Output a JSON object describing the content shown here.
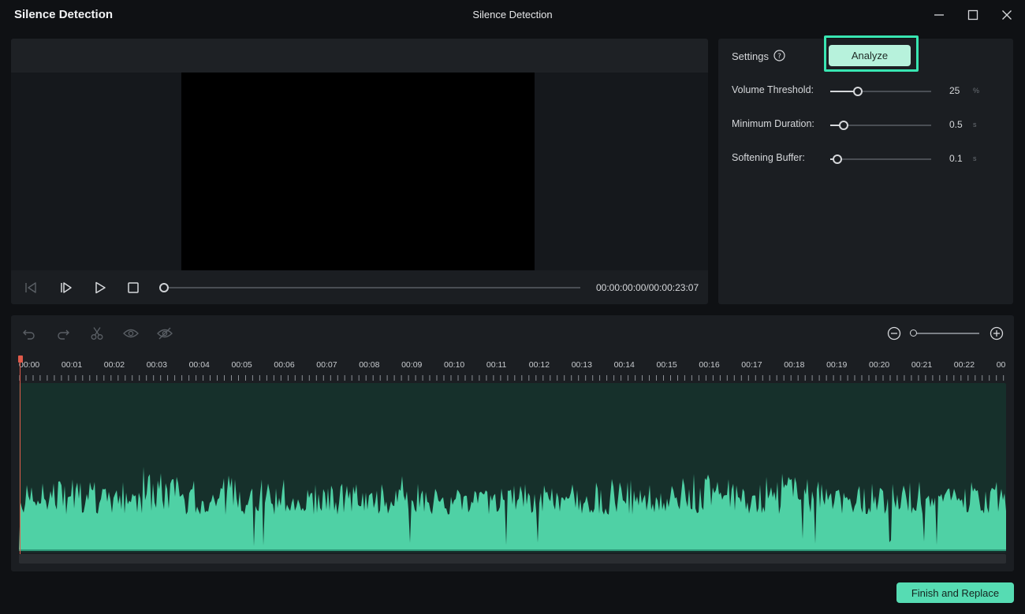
{
  "window": {
    "app_title": "Silence Detection",
    "center_title": "Silence Detection",
    "controls": [
      "minimize-icon",
      "maximize-icon",
      "close-icon"
    ]
  },
  "preview": {
    "timecode": "00:00:00:00/00:00:23:07",
    "progress": 0,
    "controls": [
      "previous-frame-icon",
      "next-frame-icon",
      "play-icon",
      "stop-icon"
    ]
  },
  "settings": {
    "label": "Settings",
    "analyze_label": "Analyze",
    "rows": [
      {
        "name": "Volume Threshold:",
        "value": "25",
        "unit": "%",
        "fraction": 0.27
      },
      {
        "name": "Minimum Duration:",
        "value": "0.5",
        "unit": "s",
        "fraction": 0.13
      },
      {
        "name": "Softening Buffer:",
        "value": "0.1",
        "unit": "s",
        "fraction": 0.07
      }
    ]
  },
  "timeline": {
    "tools": [
      "undo-icon",
      "redo-icon",
      "scissors-icon",
      "eye-icon",
      "eye-off-icon"
    ],
    "ruler_labels": [
      "00:00",
      "00:01",
      "00:02",
      "00:03",
      "00:04",
      "00:05",
      "00:06",
      "00:07",
      "00:08",
      "00:09",
      "00:10",
      "00:11",
      "00:12",
      "00:13",
      "00:14",
      "00:15",
      "00:16",
      "00:17",
      "00:18",
      "00:19",
      "00:20",
      "00:21",
      "00:22",
      "00:"
    ],
    "zoom": 0,
    "colors": {
      "waveform": "#4fd1a5",
      "track_bg": "#16302b",
      "playhead": "#e05a4a"
    }
  },
  "footer": {
    "finish_label": "Finish and Replace"
  },
  "colors": {
    "accent": "#56dcb3",
    "highlight": "#39e6b2"
  }
}
